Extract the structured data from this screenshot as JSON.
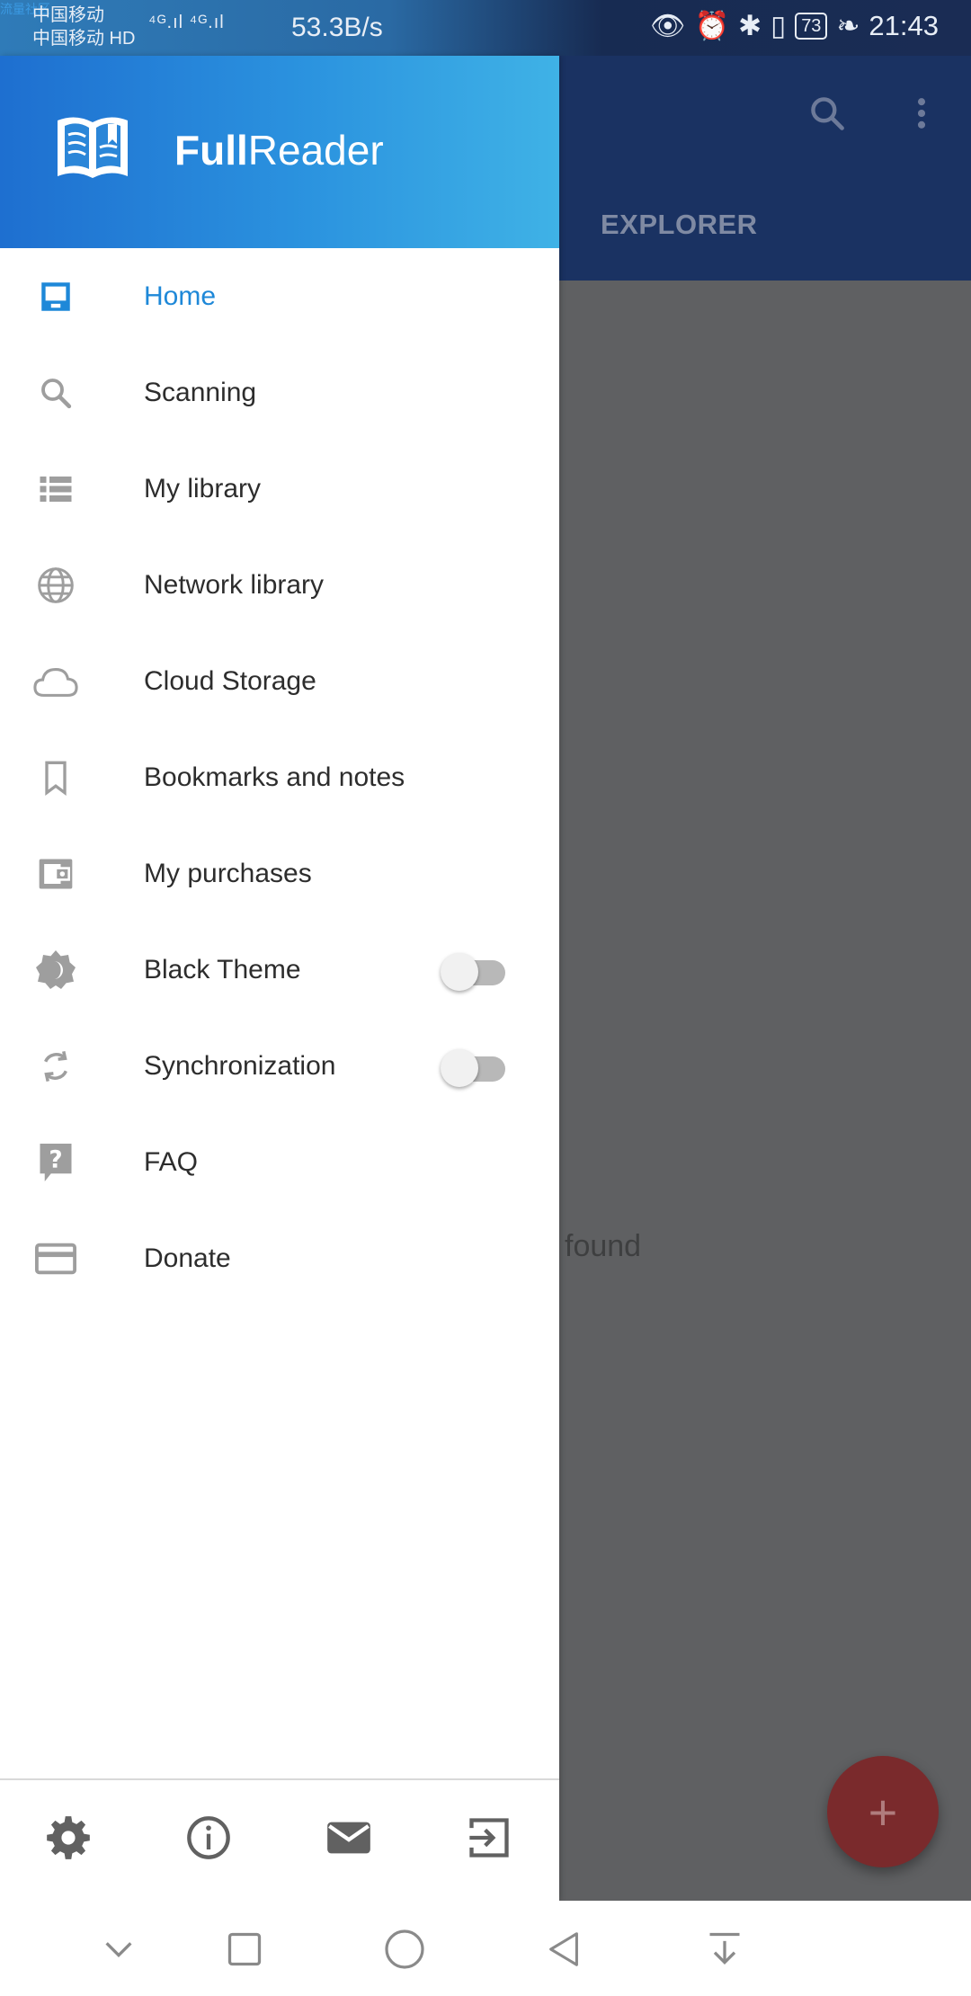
{
  "status_bar": {
    "watermark": "流量社区",
    "carrier_1": "中国移动",
    "carrier_2": "中国移动 HD",
    "signal": "⁴ᴳ.ıl ⁴ᴳ.ıl",
    "net_speed": "53.3B/s",
    "battery": "73",
    "time": "21:43"
  },
  "background_app": {
    "tab_label": "EXPLORER",
    "empty_text": "found",
    "fab_label": "+"
  },
  "drawer": {
    "app_name_bold": "Full",
    "app_name_regular": "Reader",
    "accent_color": "#1e88d8",
    "items": [
      {
        "label": "Home",
        "icon": "home-inbox-icon",
        "active": true
      },
      {
        "label": "Scanning",
        "icon": "search-icon"
      },
      {
        "label": "My library",
        "icon": "list-icon"
      },
      {
        "label": "Network library",
        "icon": "globe-icon"
      },
      {
        "label": "Cloud Storage",
        "icon": "cloud-icon"
      },
      {
        "label": "Bookmarks and notes",
        "icon": "bookmark-icon"
      },
      {
        "label": "My purchases",
        "icon": "wallet-icon"
      },
      {
        "label": "Black Theme",
        "icon": "theme-icon",
        "toggle": false
      },
      {
        "label": "Synchronization",
        "icon": "sync-icon",
        "toggle": false
      },
      {
        "label": "FAQ",
        "icon": "question-icon"
      },
      {
        "label": "Donate",
        "icon": "credit-card-icon"
      }
    ],
    "footer": [
      "settings-icon",
      "info-icon",
      "mail-icon",
      "exit-icon"
    ]
  },
  "nav_bar": [
    "chevron-down-icon",
    "recent-apps-icon",
    "home-icon",
    "back-icon",
    "notifications-pull-icon"
  ]
}
